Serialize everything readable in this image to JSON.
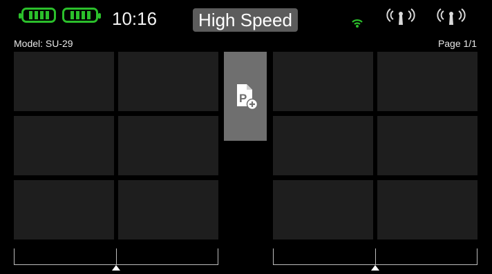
{
  "status_bar": {
    "time": "10:16",
    "flight_mode": "High Speed",
    "battery_color": "#2bbf2b",
    "icons": {
      "battery_1": "battery-full-icon",
      "battery_2": "battery-full-icon",
      "wifi": "wifi-icon",
      "antenna_1": "antenna-signal-icon",
      "antenna_2": "antenna-signal-icon"
    }
  },
  "header": {
    "model_label": "Model: SU-29",
    "page_label": "Page 1/1"
  },
  "widgets": {
    "add_icon": "add-page-icon",
    "left_tiles": 6,
    "right_tiles": 6
  },
  "trims": {
    "left_level": 0.5,
    "right_level": 0.5
  },
  "colors": {
    "background": "#000000",
    "tile": "#1e1e1e",
    "mode_button": "#5c5c5c",
    "add_tile": "#6f6f6f",
    "accent_green": "#2bbf2b"
  }
}
